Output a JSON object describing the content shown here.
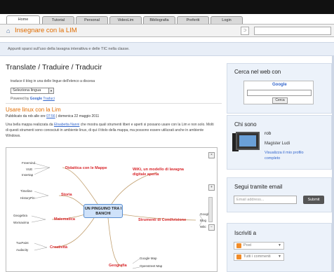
{
  "tabs": [
    "Home",
    "Tutorial",
    "Personal",
    "VideoLim",
    "Bibliografia",
    "Preferiti",
    "Login"
  ],
  "site": {
    "title": "Insegnare con la LIM",
    "home_icon": "home-icon",
    "rss_icon": "rss-icon"
  },
  "tagline": "Appunti sparsi sull'uso della lavagna interattiva e delle TIC nella classe.",
  "translate": {
    "heading": "Translate / Traduire / Traducir",
    "desc": "traduce il blog in una delle lingue dell'elenco a discesa",
    "select_value": "Seleziona lingua",
    "powered": "Powered by",
    "google": "Google",
    "traduci": "Traduci"
  },
  "post": {
    "title": "Usare linux con la Lim",
    "meta_prefix": "Pubblicato da rob alle ore",
    "meta_time": "07:56",
    "meta_suffix": "| domenica 22 maggio 2011",
    "body_1": "Una bella mappa realizzata da",
    "body_link": "Elisabetta Nanni",
    "body_2": "che mostra quali strumenti liberi e aperti si possano usare con la Lim e non solo. Molti di questi strumenti sono conosciuti in ambiente linux, di qui il titolo della mappa, ma possono essere utilizzati anche in ambiente Windows."
  },
  "mindmap": {
    "center": "UN PINGUINO TRA I BANCHI",
    "branches": [
      "Didattica con le Mappe",
      "WiKi, un modello di lavagna digitale aperta",
      "Storia",
      "Matematica",
      "Strumenti di Condivisione",
      "Creatività",
      "Geografia"
    ],
    "leaves_mappe": [
      "Freemind",
      "VUE",
      "Insertap"
    ],
    "leaves_storia": [
      "Timeline",
      "HistoryPin"
    ],
    "leaves_math": [
      "Geogebra",
      "Wxmaxima"
    ],
    "leaves_share": [
      "Google",
      "Blog",
      "Wiki"
    ],
    "leaves_creat": [
      "TuxPaint",
      "Audacity"
    ],
    "leaves_geo": [
      "Google Map",
      "Openstreet Map"
    ]
  },
  "sidebar": {
    "search": {
      "title": "Cerca nel web con",
      "google": "Google",
      "button": "Cerca"
    },
    "about": {
      "title": "Chi sono",
      "name": "rob",
      "role": "Magister Ludi",
      "link": "Visualizza il mio profilo completo"
    },
    "follow": {
      "title": "Segui tramite email",
      "placeholder": "Email address...",
      "button": "Submit"
    },
    "subscribe": {
      "title": "Iscriviti a",
      "feeds": [
        "Post",
        "Tutti i commenti"
      ]
    }
  }
}
